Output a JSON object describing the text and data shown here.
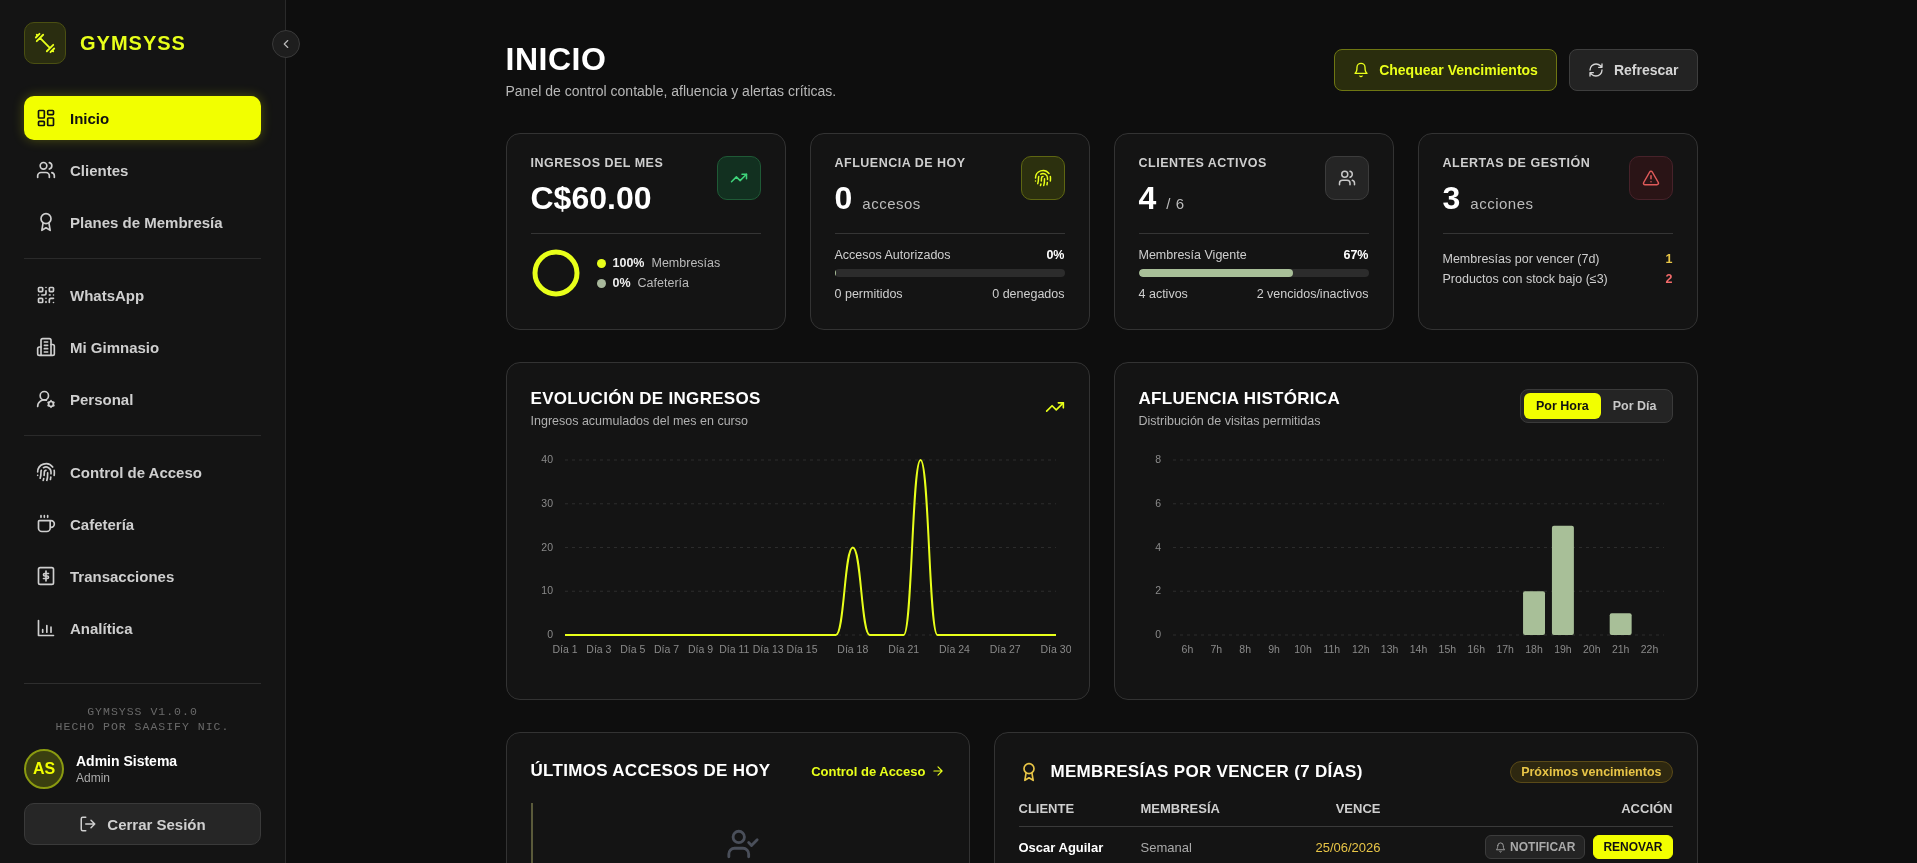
{
  "sidebar": {
    "brand": "GYMSYSS",
    "nav_groups": [
      [
        {
          "label": "Inicio",
          "selected": true
        },
        {
          "label": "Clientes",
          "selected": false
        },
        {
          "label": "Planes de Membresía",
          "selected": false
        }
      ],
      [
        {
          "label": "WhatsApp",
          "selected": false
        },
        {
          "label": "Mi Gimnasio",
          "selected": false
        },
        {
          "label": "Personal",
          "selected": false
        }
      ],
      [
        {
          "label": "Control de Acceso",
          "selected": false
        },
        {
          "label": "Cafetería",
          "selected": false
        },
        {
          "label": "Transacciones",
          "selected": false
        },
        {
          "label": "Analítica",
          "selected": false
        }
      ]
    ],
    "version": "GYMSYSS V1.0.0",
    "credit": "HECHO POR SAASIFY NIC.",
    "user": {
      "initials": "AS",
      "name": "Admin Sistema",
      "role": "Admin"
    },
    "logout": "Cerrar Sesión"
  },
  "header": {
    "title": "INICIO",
    "subtitle": "Panel de control contable, afluencia y alertas críticas.",
    "buttons": [
      {
        "label": "Chequear Vencimientos",
        "kind": "primary"
      },
      {
        "label": "Refrescar",
        "kind": "secondary"
      }
    ]
  },
  "stats": [
    {
      "kind": "revenue",
      "label": "INGRESOS DEL MES",
      "value": "C$60.00",
      "breakdown": [
        {
          "percent": "100%",
          "label": "Membresías",
          "color": "#e8ff1a"
        },
        {
          "percent": "0%",
          "label": "Cafetería",
          "color": "#a8b89c"
        }
      ]
    },
    {
      "kind": "progress",
      "label": "AFLUENCIA DE HOY",
      "value": "0",
      "unit": "accesos",
      "bar_label": "Accesos Autorizados",
      "bar_value": "0%",
      "level": 0,
      "left": "0 permitidos",
      "right": "0 denegados"
    },
    {
      "kind": "progress",
      "label": "CLIENTES ACTIVOS",
      "value": "4",
      "unit": "/ 6",
      "bar_label": "Membresía Vigente",
      "bar_value": "67%",
      "level": 0.67,
      "left": "4 activos",
      "right": "2 vencidos/inactivos"
    },
    {
      "kind": "alerts",
      "label": "ALERTAS DE GESTIÓN",
      "value": "3",
      "unit": "acciones",
      "alerts": [
        {
          "label": "Membresías por vencer (7d)",
          "count": "1",
          "color": "#e8c547"
        },
        {
          "label": "Productos con stock bajo (≤3)",
          "count": "2",
          "color": "#f26a6a"
        }
      ]
    }
  ],
  "revenue_chart": {
    "title": "EVOLUCIÓN DE INGRESOS",
    "subtitle": "Ingresos acumulados del mes en curso",
    "chart_data": {
      "type": "line",
      "categories": [
        "Día 1",
        null,
        "Día 3",
        null,
        "Día 5",
        null,
        "Día 7",
        null,
        "Día 9",
        null,
        "Día 11",
        null,
        "Día 13",
        null,
        "Día 15",
        null,
        null,
        "Día 18",
        null,
        null,
        "Día 21",
        null,
        null,
        "Día 24",
        null,
        null,
        "Día 27",
        null,
        null,
        "Día 30"
      ],
      "series": [
        {
          "color": "#e8ff1a",
          "values": [
            0,
            0,
            0,
            0,
            0,
            0,
            0,
            0,
            0,
            0,
            0,
            0,
            0,
            0,
            0,
            0,
            0,
            20,
            0,
            0,
            0,
            40,
            0,
            0,
            0,
            0,
            0,
            0,
            0,
            0
          ]
        }
      ],
      "ylim": [
        0,
        40
      ],
      "yticks": [
        0,
        10,
        20,
        30,
        40
      ],
      "grid": true
    }
  },
  "traffic_chart": {
    "title": "AFLUENCIA HISTÓRICA",
    "subtitle": "Distribución de visitas permitidas",
    "toggle": [
      {
        "label": "Por Hora",
        "selected": true
      },
      {
        "label": "Por Día",
        "selected": false
      }
    ],
    "chart_data": {
      "type": "bar",
      "categories": [
        "6h",
        "7h",
        "8h",
        "9h",
        "10h",
        "11h",
        "12h",
        "13h",
        "14h",
        "15h",
        "16h",
        "17h",
        "18h",
        "19h",
        "20h",
        "21h",
        "22h"
      ],
      "series": [
        {
          "color": "#a8bf98",
          "values": [
            0,
            0,
            0,
            0,
            0,
            0,
            0,
            0,
            0,
            0,
            0,
            0,
            2,
            5,
            0,
            1,
            0
          ]
        }
      ],
      "ylim": [
        0,
        8
      ],
      "yticks": [
        0,
        2,
        4,
        6,
        8
      ],
      "grid": true
    }
  },
  "recent_access": {
    "title": "ÚLTIMOS ACCESOS DE HOY",
    "link": "Control de Acceso"
  },
  "expiring": {
    "title": "MEMBRESÍAS POR VENCER (7 DÍAS)",
    "badge": "Próximos vencimientos",
    "columns": [
      "CLIENTE",
      "MEMBRESÍA",
      "VENCE",
      "ACCIÓN"
    ],
    "rows": [
      {
        "client": "Oscar Aguilar",
        "plan": "Semanal",
        "expires": "25/06/2026",
        "actions": [
          {
            "label": "NOTIFICAR",
            "kind": "notify"
          },
          {
            "label": "RENOVAR",
            "kind": "renew"
          }
        ]
      }
    ]
  }
}
